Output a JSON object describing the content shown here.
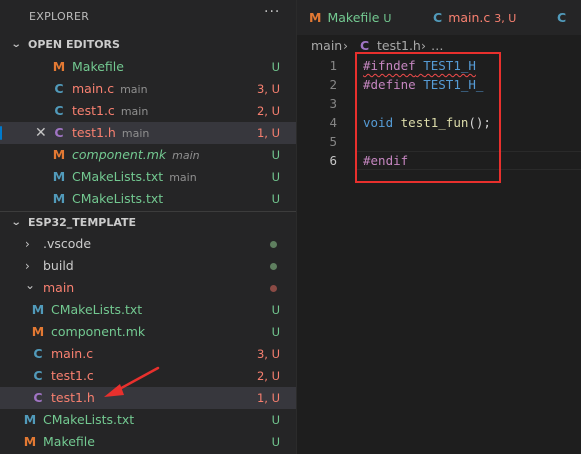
{
  "explorer": {
    "title": "EXPLORER",
    "more": "···"
  },
  "open_editors": {
    "title": "OPEN EDITORS",
    "items": [
      {
        "icon": "M",
        "name": "Makefile",
        "desc": "",
        "status": "U"
      },
      {
        "icon": "C",
        "name": "main.c",
        "desc": "main",
        "status": "3, U"
      },
      {
        "icon": "C",
        "name": "test1.c",
        "desc": "main",
        "status": "2, U"
      },
      {
        "icon": "C",
        "name": "test1.h",
        "desc": "main",
        "status": "1, U",
        "close": "✕"
      },
      {
        "icon": "M",
        "name": "component.mk",
        "desc": "main",
        "status": "U"
      },
      {
        "icon": "M",
        "name": "CMakeLists.txt",
        "desc": "main",
        "status": "U"
      },
      {
        "icon": "M",
        "name": "CMakeLists.txt",
        "desc": "",
        "status": "U"
      }
    ]
  },
  "project": {
    "title": "ESP32_TEMPLATE",
    "items": [
      {
        "chevron": "›",
        "name": ".vscode"
      },
      {
        "chevron": "›",
        "name": "build"
      },
      {
        "chevron": "⌄",
        "name": "main"
      },
      {
        "icon": "M",
        "name": "CMakeLists.txt",
        "status": "U"
      },
      {
        "icon": "M",
        "name": "component.mk",
        "status": "U"
      },
      {
        "icon": "C",
        "name": "main.c",
        "status": "3, U"
      },
      {
        "icon": "C",
        "name": "test1.c",
        "status": "2, U"
      },
      {
        "icon": "C",
        "name": "test1.h",
        "status": "1, U"
      },
      {
        "icon": "M",
        "name": "CMakeLists.txt",
        "status": "U"
      },
      {
        "icon": "M",
        "name": "Makefile",
        "status": "U"
      }
    ]
  },
  "tabs": [
    {
      "icon": "M",
      "name": "Makefile",
      "status": "U"
    },
    {
      "icon": "C",
      "name": "main.c",
      "status": "3, U"
    },
    {
      "icon": "C",
      "name": ""
    }
  ],
  "breadcrumb": {
    "folder": "main",
    "sep": "›",
    "icon": "C",
    "file": "test1.h",
    "more": "…"
  },
  "editor": {
    "line_numbers": [
      "1",
      "2",
      "3",
      "4",
      "5",
      "6"
    ],
    "lines": {
      "l1_kw": "#ifndef",
      "l1_id": "TEST1_H",
      "l2_kw": "#define",
      "l2_id": "TEST1_H_",
      "l4_type": "void",
      "l4_fn": "test1_fun",
      "l4_punct": "();",
      "l6_kw": "#endif"
    }
  },
  "colors": {
    "git_untracked": "#73c991",
    "git_error": "#f88070",
    "highlight_box": "#e8302d",
    "annotation_arrow": "#e8302d"
  }
}
